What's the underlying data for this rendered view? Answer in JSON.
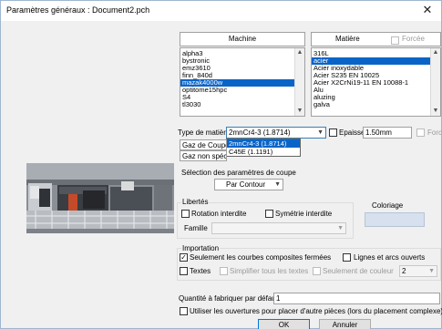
{
  "window": {
    "title": "Paramètres généraux : Document2.pch",
    "close_glyph": "✕"
  },
  "machine": {
    "header": "Machine",
    "items": [
      "alpha3",
      "bystronic",
      "emz3610",
      "finn_840d",
      "mazak4000w",
      "optitome15hpc",
      "S4",
      "tl3030"
    ],
    "selected_index": 4
  },
  "matiere": {
    "header": "Matière",
    "forcee_label": "Forcée",
    "items": [
      "316L",
      "acier",
      "Acier inoxydable",
      "Acier S235 EN 10025",
      "Acier X2CrNi19-11 EN 10088-1",
      "Alu",
      "aluzing",
      "galva"
    ],
    "selected_index": 1
  },
  "type_matiere": {
    "label": "Type de matière",
    "value": "2mnCr4-3 (1.8714)",
    "options": [
      "2mnCr4-3 (1.8714)",
      "C45E (1.1191)"
    ],
    "highlighted_index": 0
  },
  "epaisseur": {
    "label": "Epaisseur",
    "value": "1.50mm",
    "forcee_label": "Forcée"
  },
  "gaz": {
    "coupe_label": "Gaz de Coupe",
    "non_specifie_label": "Gaz non spécifié"
  },
  "selection": {
    "label": "Sélection des paramètres de coupe",
    "value": "Par Contour"
  },
  "libertes": {
    "title": "Libertés",
    "rotation_label": "Rotation interdite",
    "symetrie_label": "Symétrie interdite",
    "famille_label": "Famille",
    "famille_value": ""
  },
  "coloriage": {
    "label": "Coloriage",
    "color": "#d6e0ee"
  },
  "importation": {
    "title": "Importation",
    "courbes_label": "Seulement les courbes composites fermées",
    "courbes_checked": true,
    "lignes_label": "Lignes et arcs ouverts",
    "textes_label": "Textes",
    "simplifier_label": "Simplifier tous les textes",
    "couleur_label": "Seulement de couleur",
    "couleur_value": "2"
  },
  "quantite": {
    "label": "Quantité à fabriquer par défaut",
    "value": "1"
  },
  "ouvertures_label": "Utiliser les ouvertures pour placer d'autre pièces (lors du placement complexe)",
  "buttons": {
    "ok": "OK",
    "cancel": "Annuler"
  },
  "accent_color": "#0a64c8"
}
